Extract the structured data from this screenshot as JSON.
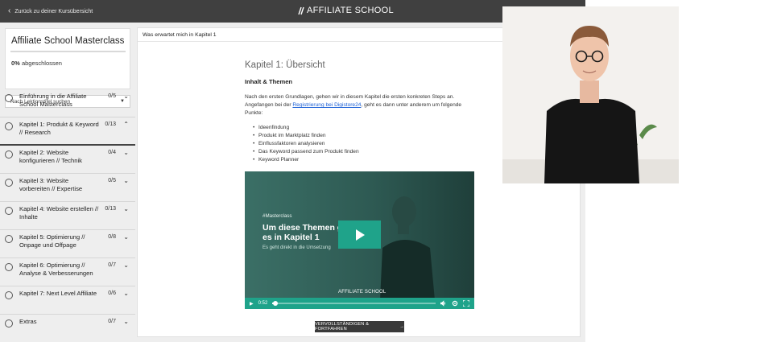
{
  "topbar": {
    "back_label": "Zurück zu deiner Kursübersicht",
    "logo_text": "AFFILIATE SCHOOL"
  },
  "sidebar": {
    "course_title": "Affiliate School Masterclass",
    "progress_value": "0%",
    "progress_suffix": "abgeschlossen",
    "progress_fraction": 0,
    "search_placeholder": "Nach Lektionstitel suchen",
    "lessons": [
      {
        "title": "Einführung in die Affiliate School Masterclass",
        "count": "0/5",
        "expanded": false
      },
      {
        "title": "Kapitel 1: Produkt & Keyword // Research",
        "count": "0/13",
        "expanded": true
      },
      {
        "title": "Kapitel 2: Website konfigurieren // Technik",
        "count": "0/4",
        "expanded": false
      },
      {
        "title": "Kapitel 3: Website vorbereiten // Expertise",
        "count": "0/5",
        "expanded": false
      },
      {
        "title": "Kapitel 4: Website erstellen // Inhalte",
        "count": "0/13",
        "expanded": false
      },
      {
        "title": "Kapitel 5: Optimierung // Onpage und Offpage",
        "count": "0/8",
        "expanded": false
      },
      {
        "title": "Kapitel 6: Optimierung // Analyse & Verbesserungen",
        "count": "0/7",
        "expanded": false
      },
      {
        "title": "Kapitel 7: Next Level Affiliate",
        "count": "0/6",
        "expanded": false
      },
      {
        "title": "Extras",
        "count": "0/7",
        "expanded": false
      }
    ]
  },
  "content": {
    "header": "Was erwartet mich in Kapitel 1",
    "heading": "Kapitel 1: Übersicht",
    "subheading": "Inhalt & Themen",
    "para_before": "Nach den ersten Grundlagen, gehen wir in diesem Kapitel die ersten konkreten Steps an. Angefangen bei der ",
    "para_link": "Registrierung bei Digistore24",
    "para_after": ", geht es dann unter anderem um folgende Punkte:",
    "points": [
      "Ideenfindung",
      "Produkt im Marktplatz finden",
      "Einflussfaktoren analysieren",
      "Das Keyword passend zum Produkt finden",
      "Keyword Planner"
    ],
    "video": {
      "tag": "#Masterclass",
      "title": "Um diese Themen geht es in Kapitel 1",
      "subtitle": "Es geht direkt in die Umsetzung",
      "logo": "AFFILIATE SCHOOL",
      "time": "0:52",
      "progress": 0.02
    },
    "complete_button": "VERVOLLSTÄNDIGEN & FORTFAHREN"
  },
  "colors": {
    "topbar": "#404040",
    "accent": "#1fa38a",
    "link": "#1a5fd6"
  }
}
